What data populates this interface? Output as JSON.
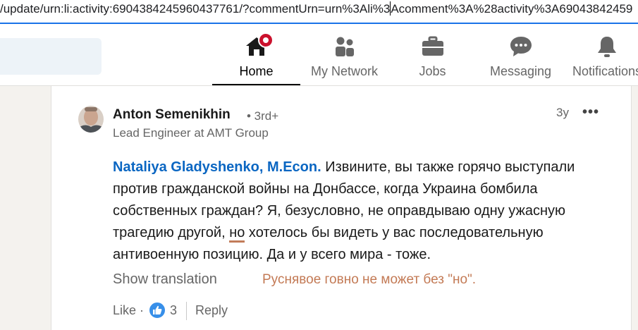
{
  "browser": {
    "url_before_caret": "/update/urn:li:activity:6904384245960437761/?commentUrn=urn%3Ali%3",
    "url_after_caret": "Acomment%3A%28activity%3A69043842459"
  },
  "nav": {
    "items": [
      {
        "label": "Home",
        "icon": "home-icon",
        "active": true,
        "notification": true
      },
      {
        "label": "My Network",
        "icon": "people-icon"
      },
      {
        "label": "Jobs",
        "icon": "briefcase-icon"
      },
      {
        "label": "Messaging",
        "icon": "chat-icon"
      },
      {
        "label": "Notifications",
        "icon": "bell-icon"
      }
    ]
  },
  "comment": {
    "author": {
      "name": "Anton Semenikhin",
      "degree": "• 3rd+",
      "headline": "Lead Engineer at AMT Group"
    },
    "time": "3y",
    "more": "•••",
    "mention": "Nataliya Gladyshenko, M.Econ.",
    "lines": [
      " Извините, вы также горячо выступали",
      "против гражданской войны на Донбассе, когда Украина бомбила",
      "собственных граждан? Я, безусловно, не оправдываю одну ужасную",
      "трагедию другой, ",
      "но",
      " хотелось бы видеть у вас последовательную",
      "антивоенную позицию. Да и у всего мира - тоже."
    ],
    "show_translation": "Show translation",
    "annotation": "Руснявое говно не может без \"но\".",
    "like_label": "Like",
    "dot": "·",
    "like_count": "3",
    "reply_label": "Reply"
  },
  "colors": {
    "link": "#0a66c2",
    "notification_badge": "#cb112d",
    "annotation": "#c37a55",
    "accent_underline": "#1a73e8"
  }
}
